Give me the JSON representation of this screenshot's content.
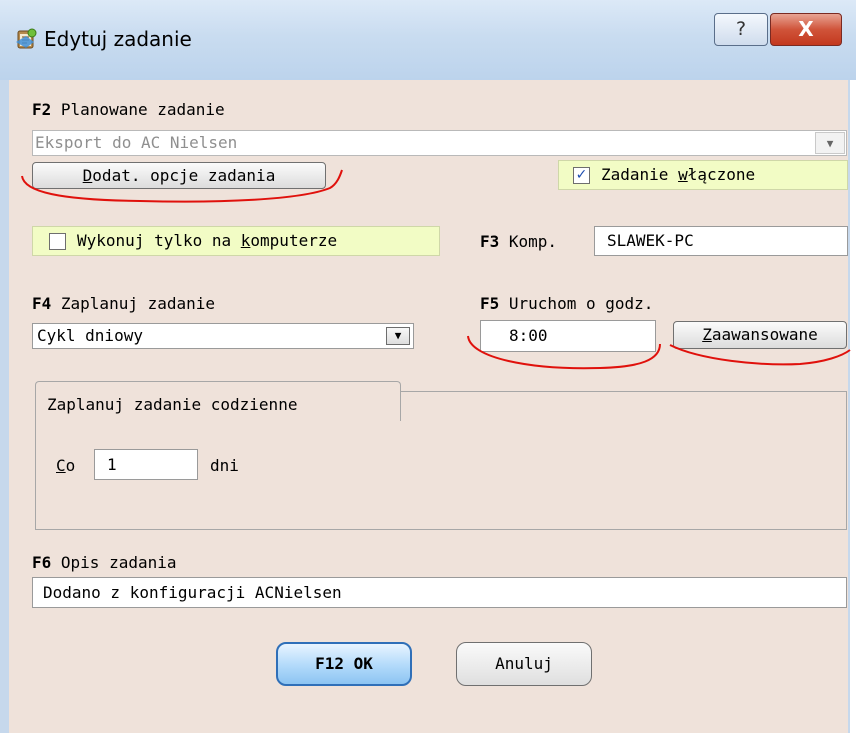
{
  "window": {
    "title": "Edytuj zadanie",
    "help_label": "?",
    "close_label": "X",
    "icon": "task-scheduler-icon"
  },
  "planned_task": {
    "key": "F2",
    "label": " Planowane zadanie",
    "value": "Eksport do AC Nielsen",
    "dropdown_icon": "chevron-down-icon",
    "extra_options_pre": "D",
    "extra_options_rest": "odat. opcje zadania"
  },
  "task_enabled": {
    "checked": true,
    "label_pre": "Zadanie ",
    "label_u": "w",
    "label_post": "łączone"
  },
  "run_only_on": {
    "checked": false,
    "label_pre": "Wykonuj tylko na ",
    "label_u": "k",
    "label_post": "omputerze"
  },
  "computer": {
    "key": "F3",
    "label": " Komp.",
    "value": "SLAWEK-PC"
  },
  "schedule": {
    "key": "F4",
    "label": " Zaplanuj zadanie",
    "value": "Cykl dniowy",
    "dropdown_icon": "chevron-down-icon"
  },
  "run_at": {
    "key": "F5",
    "label": " Uruchom o godz.",
    "value": "8:00",
    "advanced_pre": "Z",
    "advanced_rest": "aawansowane"
  },
  "daily_group": {
    "title": "Zaplanuj zadanie codzienne",
    "every_u": "C",
    "every_rest": "o",
    "every_value": "1",
    "unit": "dni"
  },
  "description": {
    "key": "F6",
    "label": " Opis zadania",
    "value": "Dodano z konfiguracji ACNielsen"
  },
  "footer": {
    "ok_label": "F12 OK",
    "cancel_label": "Anuluj"
  },
  "colors": {
    "client_bg": "#efe2da",
    "highlight_bg": "#f2fcc5",
    "annotation_red": "#e0110c",
    "ok_button_blue": "#8cc4f2"
  }
}
